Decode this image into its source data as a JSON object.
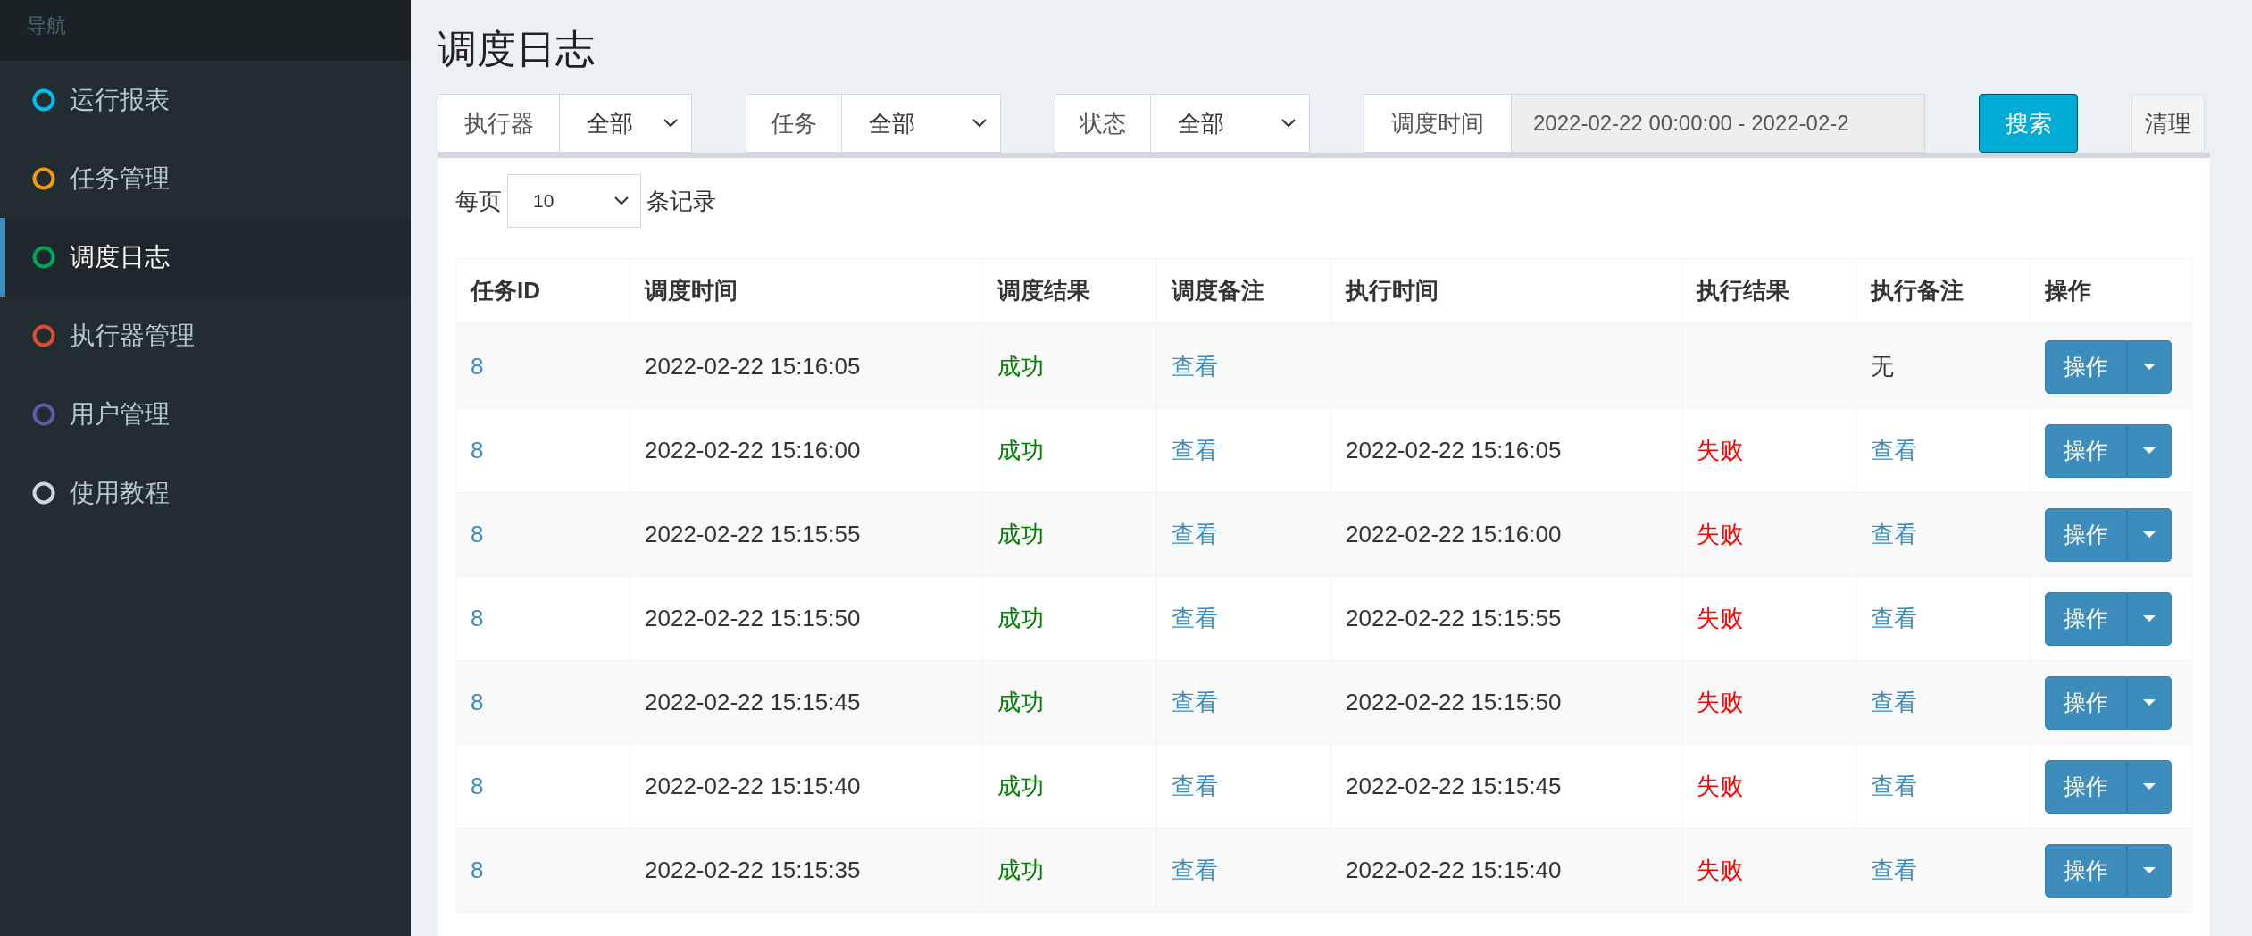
{
  "sidebar": {
    "header": "导航",
    "items": [
      {
        "label": "运行报表",
        "color": "#00c0ef",
        "selected": false
      },
      {
        "label": "任务管理",
        "color": "#f39c12",
        "selected": false
      },
      {
        "label": "调度日志",
        "color": "#00a65a",
        "selected": true
      },
      {
        "label": "执行器管理",
        "color": "#dd4b39",
        "selected": false
      },
      {
        "label": "用户管理",
        "color": "#605ca8",
        "selected": false
      },
      {
        "label": "使用教程",
        "color": "#d2d6de",
        "selected": false
      }
    ]
  },
  "page_title": "调度日志",
  "filters": [
    {
      "kind": "select",
      "label": "执行器",
      "value": "全部"
    },
    {
      "kind": "select",
      "label": "任务",
      "value": "全部"
    },
    {
      "kind": "select",
      "label": "状态",
      "value": "全部"
    },
    {
      "kind": "text",
      "label": "调度时间",
      "value": "2022-02-22 00:00:00 - 2022-02-2"
    }
  ],
  "buttons": [
    {
      "kind": "primary",
      "label": "搜索"
    },
    {
      "kind": "default",
      "label": "清理"
    }
  ],
  "page_size": {
    "prefix": "每页",
    "value": "10",
    "suffix": "条记录"
  },
  "table": {
    "columns": [
      "任务ID",
      "调度时间",
      "调度结果",
      "调度备注",
      "执行时间",
      "执行结果",
      "执行备注",
      "操作"
    ],
    "rows": [
      {
        "cells": [
          {
            "kind": "link",
            "text": "8"
          },
          {
            "kind": "text",
            "text": "2022-02-22 15:16:05"
          },
          {
            "kind": "success",
            "text": "成功"
          },
          {
            "kind": "link",
            "text": "查看"
          },
          null,
          null,
          {
            "kind": "text",
            "text": "无"
          }
        ],
        "action": "操作"
      },
      {
        "cells": [
          {
            "kind": "link",
            "text": "8"
          },
          {
            "kind": "text",
            "text": "2022-02-22 15:16:00"
          },
          {
            "kind": "success",
            "text": "成功"
          },
          {
            "kind": "link",
            "text": "查看"
          },
          {
            "kind": "text",
            "text": "2022-02-22 15:16:05"
          },
          {
            "kind": "fail",
            "text": "失败"
          },
          {
            "kind": "link",
            "text": "查看"
          }
        ],
        "action": "操作"
      },
      {
        "cells": [
          {
            "kind": "link",
            "text": "8"
          },
          {
            "kind": "text",
            "text": "2022-02-22 15:15:55"
          },
          {
            "kind": "success",
            "text": "成功"
          },
          {
            "kind": "link",
            "text": "查看"
          },
          {
            "kind": "text",
            "text": "2022-02-22 15:16:00"
          },
          {
            "kind": "fail",
            "text": "失败"
          },
          {
            "kind": "link",
            "text": "查看"
          }
        ],
        "action": "操作"
      },
      {
        "cells": [
          {
            "kind": "link",
            "text": "8"
          },
          {
            "kind": "text",
            "text": "2022-02-22 15:15:50"
          },
          {
            "kind": "success",
            "text": "成功"
          },
          {
            "kind": "link",
            "text": "查看"
          },
          {
            "kind": "text",
            "text": "2022-02-22 15:15:55"
          },
          {
            "kind": "fail",
            "text": "失败"
          },
          {
            "kind": "link",
            "text": "查看"
          }
        ],
        "action": "操作"
      },
      {
        "cells": [
          {
            "kind": "link",
            "text": "8"
          },
          {
            "kind": "text",
            "text": "2022-02-22 15:15:45"
          },
          {
            "kind": "success",
            "text": "成功"
          },
          {
            "kind": "link",
            "text": "查看"
          },
          {
            "kind": "text",
            "text": "2022-02-22 15:15:50"
          },
          {
            "kind": "fail",
            "text": "失败"
          },
          {
            "kind": "link",
            "text": "查看"
          }
        ],
        "action": "操作"
      },
      {
        "cells": [
          {
            "kind": "link",
            "text": "8"
          },
          {
            "kind": "text",
            "text": "2022-02-22 15:15:40"
          },
          {
            "kind": "success",
            "text": "成功"
          },
          {
            "kind": "link",
            "text": "查看"
          },
          {
            "kind": "text",
            "text": "2022-02-22 15:15:45"
          },
          {
            "kind": "fail",
            "text": "失败"
          },
          {
            "kind": "link",
            "text": "查看"
          }
        ],
        "action": "操作"
      },
      {
        "cells": [
          {
            "kind": "link",
            "text": "8"
          },
          {
            "kind": "text",
            "text": "2022-02-22 15:15:35"
          },
          {
            "kind": "success",
            "text": "成功"
          },
          {
            "kind": "link",
            "text": "查看"
          },
          {
            "kind": "text",
            "text": "2022-02-22 15:15:40"
          },
          {
            "kind": "fail",
            "text": "失败"
          },
          {
            "kind": "link",
            "text": "查看"
          }
        ],
        "action": "操作"
      }
    ]
  }
}
